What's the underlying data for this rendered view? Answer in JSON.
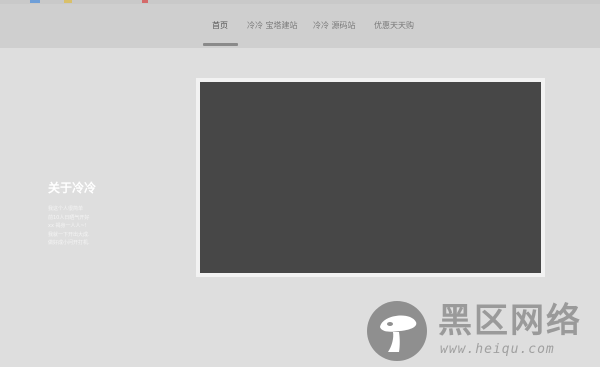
{
  "nav": {
    "items": [
      {
        "label": "首页",
        "active": true
      },
      {
        "label": "冷冷 宝塔建站",
        "active": false
      },
      {
        "label": "冷冷 源码站",
        "active": false
      },
      {
        "label": "优惠天天购",
        "active": false
      }
    ]
  },
  "about": {
    "title": "关于冷冷",
    "lines": [
      "我这个人很简单",
      "前10人日晒气开好",
      "xx 褐身一人人~!",
      "我就一下开出大成.",
      "做好成小问开打机."
    ]
  },
  "video": {
    "screen_color": "#474747"
  },
  "watermark": {
    "title": "黑区网络",
    "url": "www.heiqu.com",
    "icon": "mushroom-icon"
  },
  "colors": {
    "background": "#dedede",
    "header": "#cfcfcf",
    "accent_underline": "#8a8a8a"
  }
}
